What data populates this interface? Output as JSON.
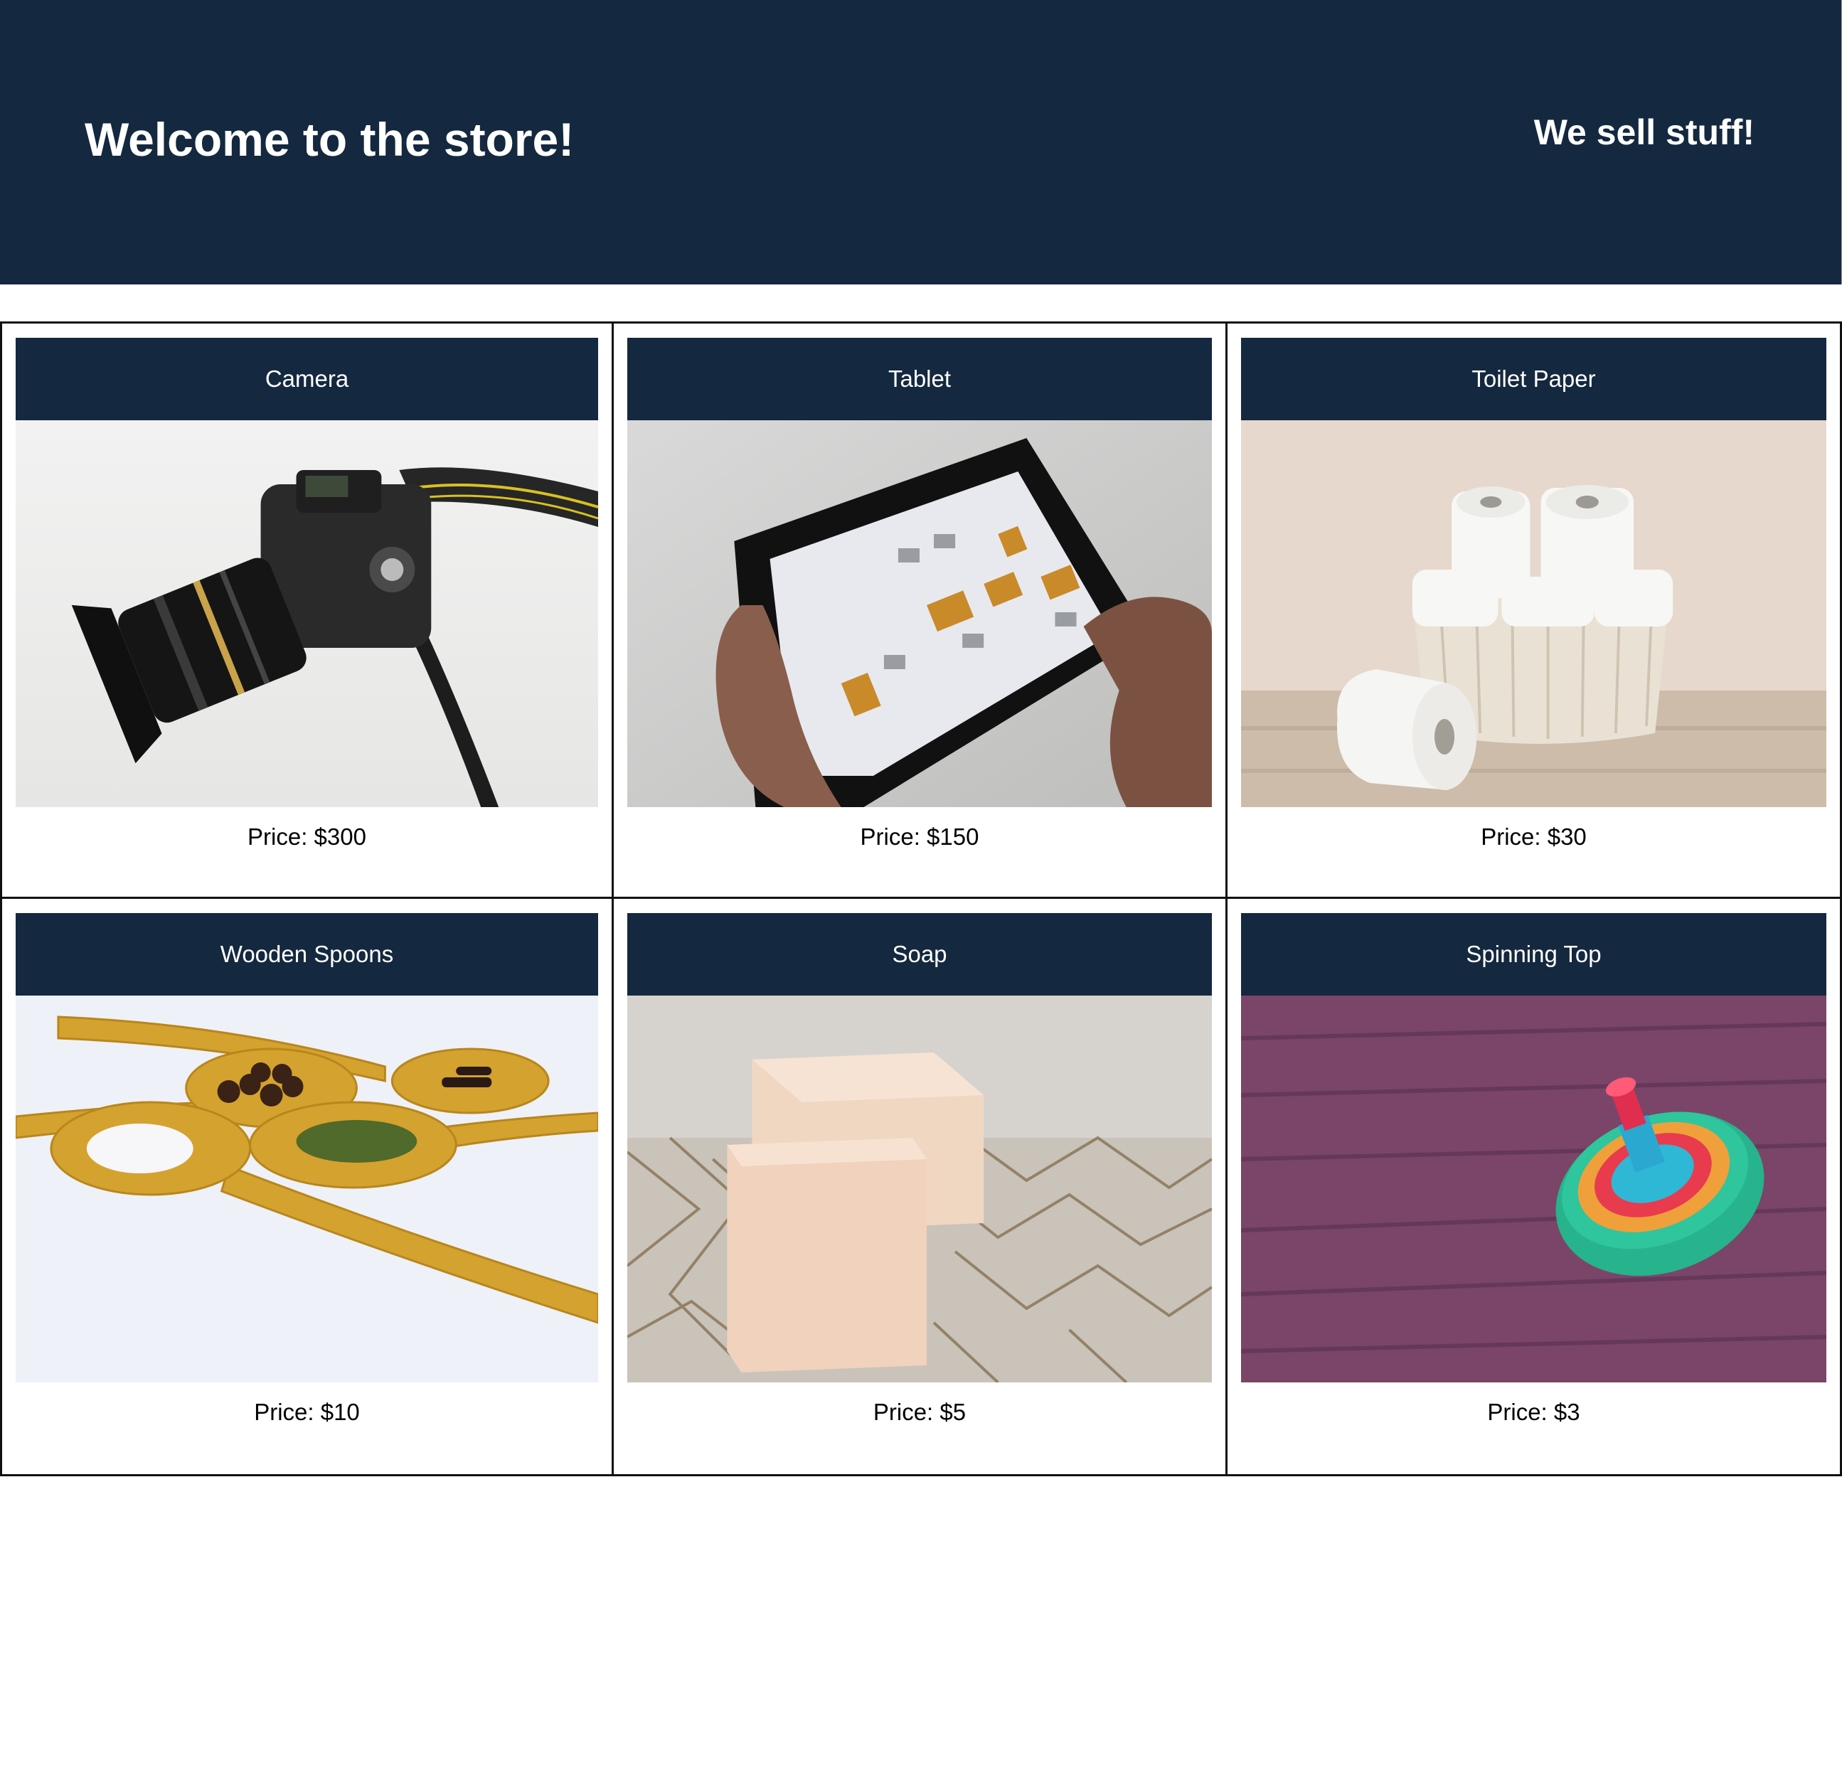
{
  "header": {
    "title": "Welcome to the store!",
    "tagline": "We sell stuff!"
  },
  "colors": {
    "header_bg": "#14283f",
    "header_text": "#ffffff",
    "card_border": "#111111"
  },
  "products": [
    {
      "name": "Camera",
      "price": "Price: $300",
      "image": "camera-photo"
    },
    {
      "name": "Tablet",
      "price": "Price: $150",
      "image": "tablet-photo"
    },
    {
      "name": "Toilet Paper",
      "price": "Price: $30",
      "image": "toilet-paper-photo"
    },
    {
      "name": "Wooden Spoons",
      "price": "Price: $10",
      "image": "wooden-spoons-photo"
    },
    {
      "name": "Soap",
      "price": "Price: $5",
      "image": "soap-photo"
    },
    {
      "name": "Spinning Top",
      "price": "Price: $3",
      "image": "spinning-top-photo"
    }
  ]
}
